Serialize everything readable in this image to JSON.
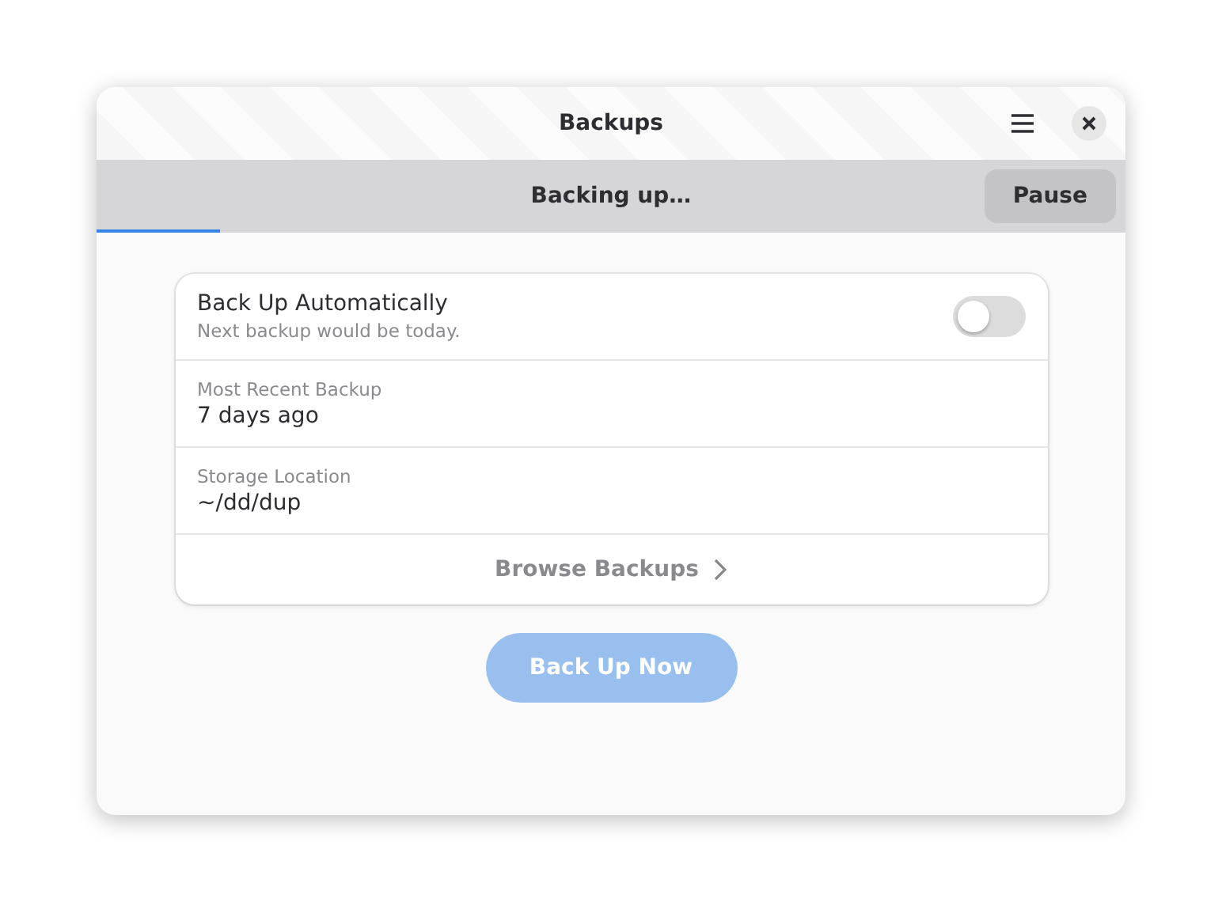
{
  "window": {
    "title": "Backups"
  },
  "banner": {
    "text": "Backing up…",
    "button": "Pause",
    "level": 0.12
  },
  "auto_backup": {
    "label": "Back Up Automatically",
    "subtitle": "Next backup would be today.",
    "on": false
  },
  "info_rows": [
    {
      "label": "Most Recent Backup",
      "value": "7 days ago"
    },
    {
      "label": "Storage Location",
      "value": "~/dd/dup"
    }
  ],
  "browse": {
    "label": "Browse Backups"
  },
  "back_up_now": {
    "label": "Back Up Now",
    "disabled": true
  }
}
